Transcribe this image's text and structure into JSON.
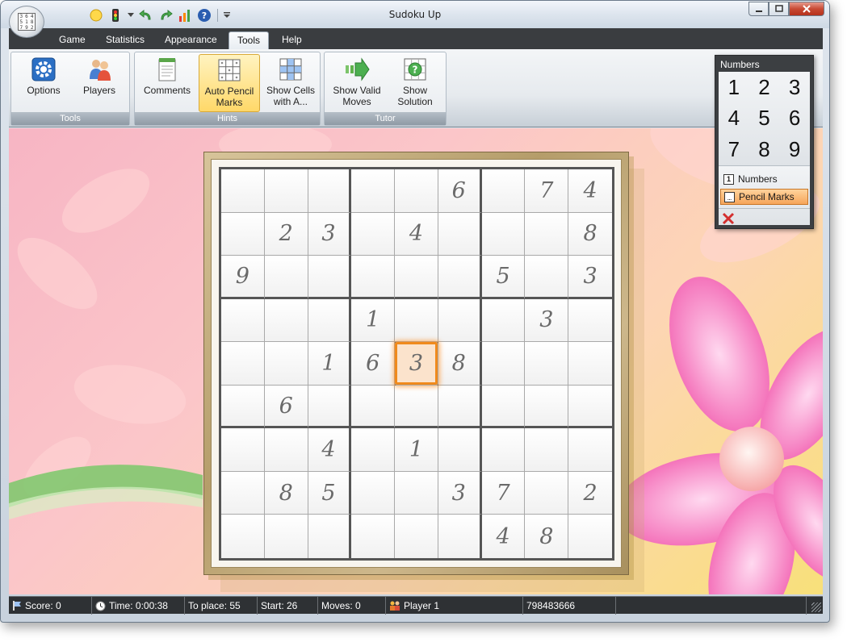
{
  "window": {
    "title": "Sudoku Up"
  },
  "quick_access": {
    "icons": [
      "hint-bulb-icon",
      "traffic-light-icon",
      "dropdown-arrow-icon",
      "undo-icon",
      "redo-icon",
      "statistics-chart-icon",
      "help-icon",
      "customize-arrow-icon"
    ]
  },
  "tabs": [
    {
      "label": "Game"
    },
    {
      "label": "Statistics"
    },
    {
      "label": "Appearance"
    },
    {
      "label": "Tools",
      "active": true
    },
    {
      "label": "Help"
    }
  ],
  "ribbon": {
    "groups": [
      {
        "label": "Tools",
        "buttons": [
          {
            "label": "Options",
            "icon": "gear-icon"
          },
          {
            "label": "Players",
            "icon": "players-icon"
          }
        ]
      },
      {
        "label": "Hints",
        "buttons": [
          {
            "label": "Comments",
            "icon": "notepad-icon"
          },
          {
            "label": "Auto Pencil Marks",
            "icon": "pencil-grid-icon",
            "active": true
          },
          {
            "label": "Show Cells with A...",
            "icon": "highlight-grid-icon"
          }
        ]
      },
      {
        "label": "Tutor",
        "buttons": [
          {
            "label": "Show Valid Moves",
            "icon": "arrow-right-icon"
          },
          {
            "label": "Show Solution",
            "icon": "question-grid-icon"
          }
        ]
      }
    ]
  },
  "board": {
    "rows": [
      [
        "",
        "",
        "",
        "",
        "",
        "6",
        "",
        "7",
        "4"
      ],
      [
        "",
        "2",
        "3",
        "",
        "4",
        "",
        "",
        "",
        "8"
      ],
      [
        "9",
        "",
        "",
        "",
        "",
        "",
        "5",
        "",
        "3"
      ],
      [
        "",
        "",
        "",
        "1",
        "",
        "",
        "",
        "3",
        ""
      ],
      [
        "",
        "",
        "1",
        "6",
        "3",
        "8",
        "",
        "",
        ""
      ],
      [
        "",
        "6",
        "",
        "",
        "",
        "",
        "",
        "",
        ""
      ],
      [
        "",
        "",
        "4",
        "",
        "1",
        "",
        "",
        "",
        ""
      ],
      [
        "",
        "8",
        "5",
        "",
        "",
        "3",
        "7",
        "",
        "2"
      ],
      [
        "",
        "",
        "",
        "",
        "",
        "",
        "4",
        "8",
        ""
      ]
    ],
    "selected": {
      "row": 5,
      "col": 5
    }
  },
  "numbers_panel": {
    "title": "Numbers",
    "keys": [
      "1",
      "2",
      "3",
      "4",
      "5",
      "6",
      "7",
      "8",
      "9"
    ],
    "modes": [
      {
        "label": "Numbers",
        "icon": "number-one-icon"
      },
      {
        "label": "Pencil Marks",
        "icon": "pencil-marks-icon",
        "active": true
      }
    ],
    "clear_icon": "clear-x-icon"
  },
  "status": {
    "score": "Score: 0",
    "time": "Time: 0:00:38",
    "to_place": "To place: 55",
    "start": "Start: 26",
    "moves": "Moves: 0",
    "player": "Player 1",
    "game_id": "798483666"
  }
}
